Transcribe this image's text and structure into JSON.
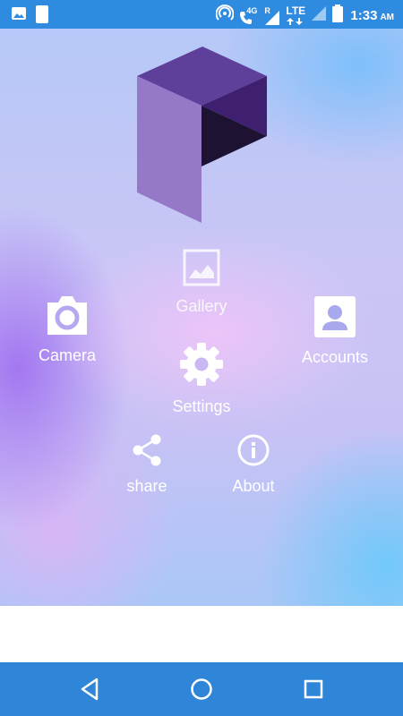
{
  "status_bar": {
    "time": "1:33",
    "ampm": "AM",
    "network_tag": "4G",
    "roaming_tag": "R",
    "lte_label": "LTE",
    "icons": [
      "image-notification-icon",
      "sim-notification-icon",
      "hotspot-icon",
      "volte-call-icon",
      "signal-icon",
      "battery-icon"
    ]
  },
  "menu": {
    "gallery": "Gallery",
    "camera": "Camera",
    "accounts": "Accounts",
    "settings": "Settings",
    "share": "share",
    "about": "About"
  },
  "colors": {
    "status_bar": "#2f8be0",
    "nav_bar": "#2f86d9",
    "logo_light": "#9678c8",
    "logo_top": "#5e3f9a",
    "logo_right": "#3e1f70",
    "logo_dark": "#1e1233"
  },
  "nav": {
    "icons": [
      "back-icon",
      "home-icon",
      "recents-icon"
    ]
  }
}
